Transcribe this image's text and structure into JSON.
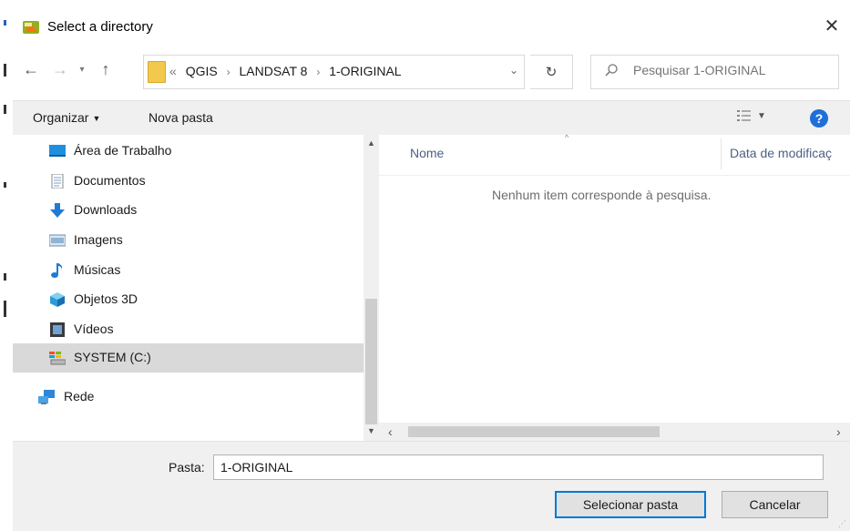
{
  "dialog": {
    "title": "Select a directory",
    "close_glyph": "✕"
  },
  "address": {
    "overflow": "«",
    "crumbs": [
      "QGIS",
      "LANDSAT 8",
      "1-ORIGINAL"
    ],
    "separator": "›"
  },
  "search": {
    "placeholder": "Pesquisar 1-ORIGINAL"
  },
  "toolbar": {
    "organize": "Organizar",
    "new_folder": "Nova pasta",
    "help": "?"
  },
  "nav": {
    "items": [
      {
        "label": "Área de Trabalho",
        "icon": "desktop-icon"
      },
      {
        "label": "Documentos",
        "icon": "documents-icon"
      },
      {
        "label": "Downloads",
        "icon": "download-arrow-icon"
      },
      {
        "label": "Imagens",
        "icon": "pictures-icon"
      },
      {
        "label": "Músicas",
        "icon": "music-note-icon"
      },
      {
        "label": "Objetos 3D",
        "icon": "cube-3d-icon"
      },
      {
        "label": "Vídeos",
        "icon": "film-icon"
      },
      {
        "label": "SYSTEM (C:)",
        "icon": "drive-icon",
        "selected": true
      },
      {
        "label": "Rede",
        "icon": "network-icon"
      }
    ]
  },
  "content": {
    "columns": [
      "Nome",
      "Data de modificaç"
    ],
    "empty_message": "Nenhum item corresponde à pesquisa."
  },
  "bottom": {
    "folder_label": "Pasta:",
    "folder_value": "1-ORIGINAL",
    "select_button": "Selecionar pasta",
    "cancel_button": "Cancelar"
  },
  "colors": {
    "accent": "#0078d7",
    "selection": "#d9d9d9",
    "help_blue": "#1e6fd9",
    "folder_yellow": "#f2c94c"
  }
}
